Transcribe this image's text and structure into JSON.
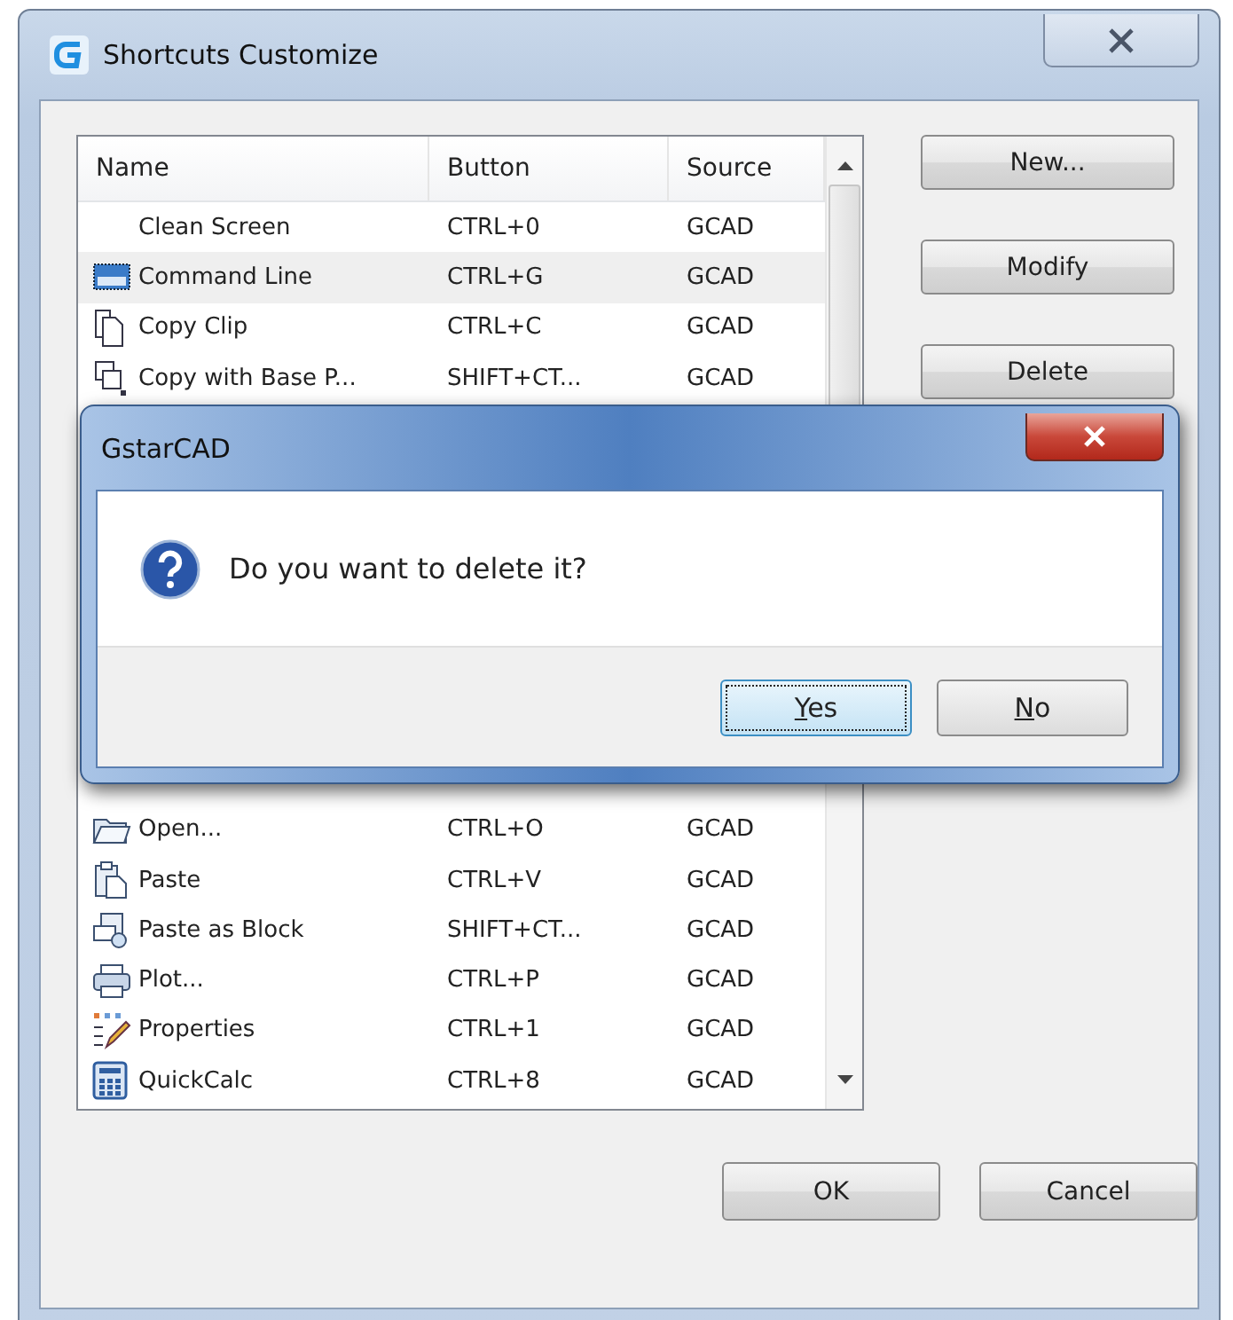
{
  "window": {
    "title": "Shortcuts Customize"
  },
  "table": {
    "columns": [
      "Name",
      "Button",
      "Source"
    ],
    "rows_top": [
      {
        "name": "Clean Screen",
        "button": "CTRL+0",
        "source": "GCAD",
        "selected": false
      },
      {
        "name": "Command Line",
        "button": "CTRL+G",
        "source": "GCAD",
        "selected": true
      },
      {
        "name": "Copy Clip",
        "button": "CTRL+C",
        "source": "GCAD",
        "selected": false
      },
      {
        "name": "Copy with Base P...",
        "button": "SHIFT+CT...",
        "source": "GCAD",
        "selected": false
      }
    ],
    "rows_bottom": [
      {
        "name": "Open...",
        "button": "CTRL+O",
        "source": "GCAD",
        "selected": false
      },
      {
        "name": "Paste",
        "button": "CTRL+V",
        "source": "GCAD",
        "selected": false
      },
      {
        "name": "Paste as Block",
        "button": "SHIFT+CT...",
        "source": "GCAD",
        "selected": false
      },
      {
        "name": "Plot...",
        "button": "CTRL+P",
        "source": "GCAD",
        "selected": false
      },
      {
        "name": "Properties",
        "button": "CTRL+1",
        "source": "GCAD",
        "selected": false
      },
      {
        "name": "QuickCalc",
        "button": "CTRL+8",
        "source": "GCAD",
        "selected": false
      }
    ]
  },
  "side_buttons": [
    "New...",
    "Modify",
    "Delete"
  ],
  "bottom_buttons": [
    "OK",
    "Cancel"
  ],
  "message_box": {
    "title": "GstarCAD",
    "message": "Do you want to delete it?",
    "buttons": [
      {
        "label": "Yes",
        "default": true
      },
      {
        "label": "No",
        "default": false
      }
    ]
  }
}
